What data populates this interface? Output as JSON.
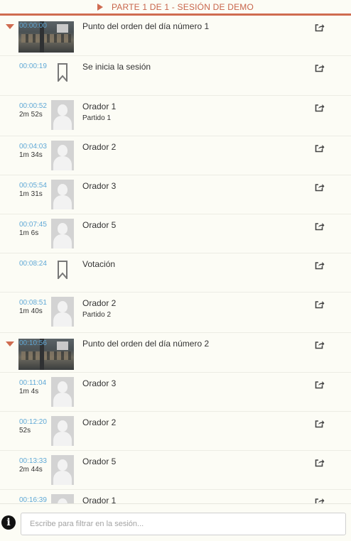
{
  "header": {
    "title": "PARTE 1 DE 1 - SESIÓN DE DEMO"
  },
  "entries": [
    {
      "kind": "point",
      "time": "00:00:00",
      "duration": "",
      "title": "Punto del orden del día número 1",
      "sub": ""
    },
    {
      "kind": "marker",
      "time": "00:00:19",
      "duration": "",
      "title": "Se inicia la sesión",
      "sub": ""
    },
    {
      "kind": "speaker",
      "time": "00:00:52",
      "duration": "2m 52s",
      "title": "Orador 1",
      "sub": "Partido 1"
    },
    {
      "kind": "speaker",
      "time": "00:04:03",
      "duration": "1m 34s",
      "title": "Orador 2",
      "sub": ""
    },
    {
      "kind": "speaker",
      "time": "00:05:54",
      "duration": "1m 31s",
      "title": "Orador 3",
      "sub": ""
    },
    {
      "kind": "speaker",
      "time": "00:07:45",
      "duration": "1m 6s",
      "title": "Orador 5",
      "sub": ""
    },
    {
      "kind": "marker",
      "time": "00:08:24",
      "duration": "",
      "title": "Votación",
      "sub": ""
    },
    {
      "kind": "speaker",
      "time": "00:08:51",
      "duration": "1m 40s",
      "title": "Orador 2",
      "sub": "Partido 2"
    },
    {
      "kind": "point",
      "time": "00:10:56",
      "duration": "",
      "title": "Punto del orden del día número 2",
      "sub": ""
    },
    {
      "kind": "speaker",
      "time": "00:11:04",
      "duration": "1m 4s",
      "title": "Orador 3",
      "sub": ""
    },
    {
      "kind": "speaker",
      "time": "00:12:20",
      "duration": "52s",
      "title": "Orador 2",
      "sub": ""
    },
    {
      "kind": "speaker",
      "time": "00:13:33",
      "duration": "2m 44s",
      "title": "Orador 5",
      "sub": ""
    },
    {
      "kind": "speaker",
      "time": "00:16:39",
      "duration": "",
      "title": "Orador 1",
      "sub": ""
    }
  ],
  "filter": {
    "placeholder": "Escribe para filtrar en la sesión..."
  },
  "icons": {
    "info": "info-icon",
    "share": "share-icon",
    "bookmark": "bookmark-icon",
    "caret": "caret-down-icon",
    "play": "play-triangle-icon"
  },
  "colors": {
    "accent": "#cf6b50",
    "time": "#5fa8d6",
    "background": "#fcfcf5"
  }
}
